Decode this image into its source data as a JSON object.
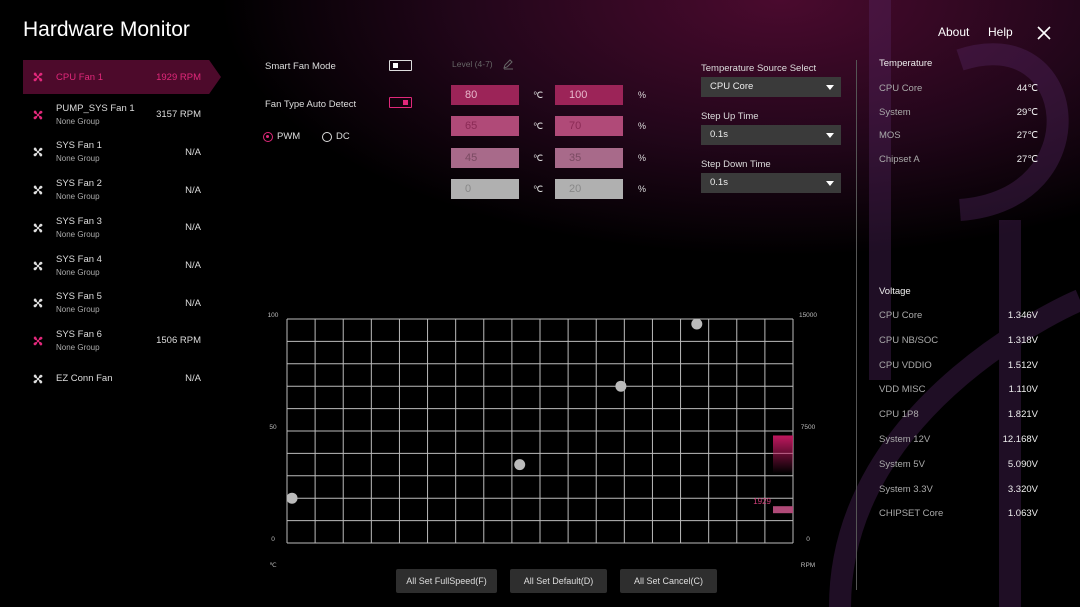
{
  "header": {
    "title": "Hardware Monitor",
    "about": "About",
    "help": "Help"
  },
  "colors": {
    "accent": "#e0287a",
    "selected_bg": "#4d0a2b"
  },
  "fans": [
    {
      "name": "CPU Fan 1",
      "group": "",
      "rpm": "1929 RPM",
      "active": true,
      "selected": true
    },
    {
      "name": "PUMP_SYS Fan 1",
      "group": "None Group",
      "rpm": "3157 RPM",
      "active": true
    },
    {
      "name": "SYS Fan 1",
      "group": "None Group",
      "rpm": "N/A"
    },
    {
      "name": "SYS Fan 2",
      "group": "None Group",
      "rpm": "N/A"
    },
    {
      "name": "SYS Fan 3",
      "group": "None Group",
      "rpm": "N/A"
    },
    {
      "name": "SYS Fan 4",
      "group": "None Group",
      "rpm": "N/A"
    },
    {
      "name": "SYS Fan 5",
      "group": "None Group",
      "rpm": "N/A"
    },
    {
      "name": "SYS Fan 6",
      "group": "None Group",
      "rpm": "1506 RPM",
      "active": true
    },
    {
      "name": "EZ Conn Fan",
      "group": "",
      "rpm": "N/A"
    }
  ],
  "settings": {
    "smart_fan_mode": "Smart Fan Mode",
    "smart_fan_on": false,
    "fan_type_auto": "Fan Type Auto Detect",
    "fan_type_on": true,
    "pwm": "PWM",
    "dc": "DC",
    "mode": "PWM",
    "level": "Level (4-7)"
  },
  "levels": [
    {
      "temp": "80",
      "pct": "100",
      "deg": "℃",
      "pc": "%"
    },
    {
      "temp": "65",
      "pct": "70",
      "deg": "℃",
      "pc": "%"
    },
    {
      "temp": "45",
      "pct": "35",
      "deg": "℃",
      "pc": "%"
    },
    {
      "temp": "0",
      "pct": "20",
      "deg": "℃",
      "pc": "%"
    }
  ],
  "source": {
    "label": "Temperature Source Select",
    "value": "CPU Core",
    "step_up_label": "Step Up Time",
    "step_up": "0.1s",
    "step_down_label": "Step Down Time",
    "step_down": "0.1s"
  },
  "temperature": {
    "title": "Temperature",
    "items": [
      {
        "name": "CPU Core",
        "value": "44℃"
      },
      {
        "name": "System",
        "value": "29℃"
      },
      {
        "name": "MOS",
        "value": "27℃"
      },
      {
        "name": "Chipset A",
        "value": "27℃"
      }
    ]
  },
  "voltage": {
    "title": "Voltage",
    "items": [
      {
        "name": "CPU Core",
        "value": "1.346V"
      },
      {
        "name": "CPU NB/SOC",
        "value": "1.318V"
      },
      {
        "name": "CPU VDDIO",
        "value": "1.512V"
      },
      {
        "name": "VDD MISC",
        "value": "1.110V"
      },
      {
        "name": "CPU 1P8",
        "value": "1.821V"
      },
      {
        "name": "System 12V",
        "value": "12.168V"
      },
      {
        "name": "System 5V",
        "value": "5.090V"
      },
      {
        "name": "System 3.3V",
        "value": "3.320V"
      },
      {
        "name": "CHIPSET Core",
        "value": "1.063V"
      }
    ]
  },
  "chart_data": {
    "type": "scatter",
    "points": [
      {
        "x": 0,
        "y": 20
      },
      {
        "x": 45,
        "y": 35
      },
      {
        "x": 65,
        "y": 70
      },
      {
        "x": 80,
        "y": 100
      }
    ],
    "xlim": [
      0,
      100
    ],
    "ylim": [
      0,
      100
    ],
    "y_ticks": [
      "100",
      "50",
      "0"
    ],
    "y_unit": "℃",
    "y2_ticks": [
      "15000",
      "7500",
      "0"
    ],
    "y2_unit": "RPM",
    "y2lim": [
      0,
      15000
    ],
    "current_rpm": 1929,
    "current_rpm_label": "1929",
    "grid": true
  },
  "buttons": {
    "full": "All Set FullSpeed(F)",
    "default": "All Set Default(D)",
    "cancel": "All Set Cancel(C)"
  }
}
